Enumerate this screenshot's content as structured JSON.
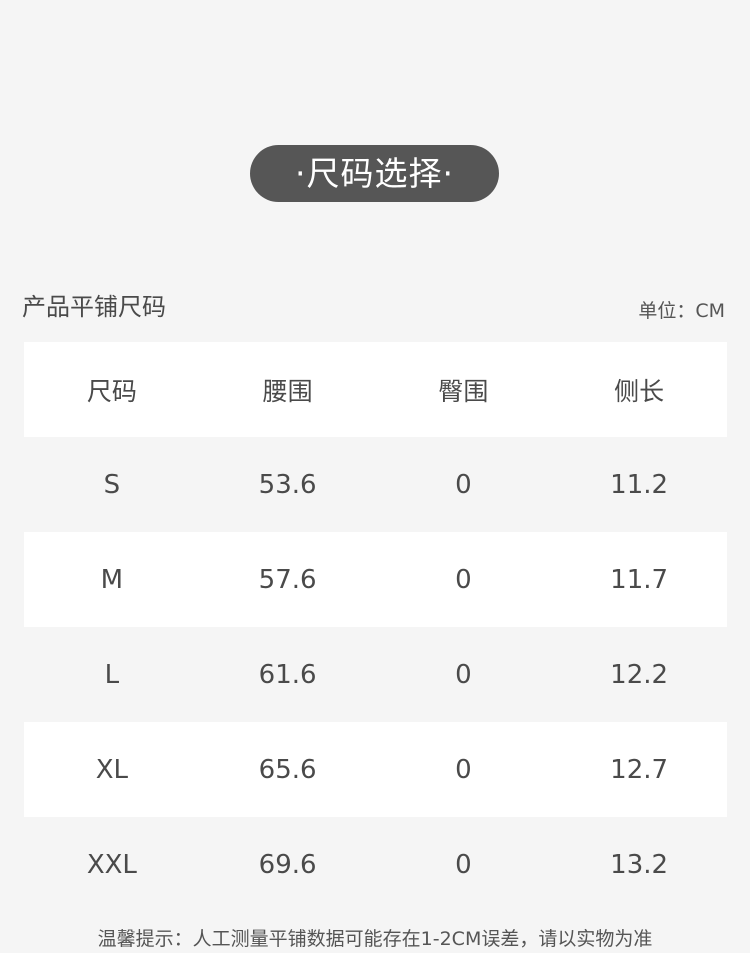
{
  "title": "·尺码选择·",
  "table_title": "产品平铺尺码",
  "unit_label": "单位：CM",
  "table": {
    "headers": [
      "尺码",
      "腰围",
      "臀围",
      "侧长"
    ],
    "rows": [
      [
        "S",
        "53.6",
        "0",
        "11.2"
      ],
      [
        "M",
        "57.6",
        "0",
        "11.7"
      ],
      [
        "L",
        "61.6",
        "0",
        "12.2"
      ],
      [
        "XL",
        "65.6",
        "0",
        "12.7"
      ],
      [
        "XXL",
        "69.6",
        "0",
        "13.2"
      ]
    ]
  },
  "notice": "温馨提示：人工测量平铺数据可能存在1-2CM误差，请以实物为准",
  "colors": {
    "background": "#f5f5f5",
    "pill": "#565656",
    "row_white": "#ffffff",
    "text": "#4a4a4a"
  }
}
